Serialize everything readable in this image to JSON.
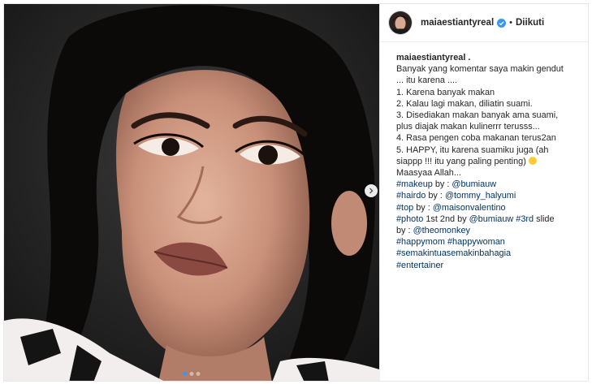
{
  "post": {
    "username": "maiaestiantyreal",
    "separator": "•",
    "follow_label": "Diikuti",
    "caption_author": "maiaestiantyreal .",
    "caption_lines": [
      "Banyak yang komentar saya makin gendut",
      "... itu karena ....",
      "1. Karena banyak makan",
      "2. Kalau lagi makan, diliatin suami.",
      "3. Disediakan makan banyak ama suami,",
      "plus diajak makan kulinerrr terusss...",
      "4. Rasa pengen coba makanan terus2an",
      "5. HAPPY, itu karena suamiku juga (ah",
      "siappp !!! itu yang paling penting)",
      "Maasyaa Allah..."
    ],
    "credits": {
      "makeup_tag": "#makeup",
      "makeup_by": " by : ",
      "makeup_mention": "@bumiauw",
      "hairdo_tag": "#hairdo",
      "hairdo_by": " by : ",
      "hairdo_mention": "@tommy_halyumi",
      "top_tag": "#top",
      "top_by": " by : ",
      "top_mention": "@maisonvalentino",
      "photo_tag": "#photo",
      "photo_text": " 1st 2nd by ",
      "photo_mention": "@bumiauw",
      "slide_tag": "#3rd",
      "slide_text": " slide",
      "by_label": "by : ",
      "theomonkey": "@theomonkey"
    },
    "hashtags_line1": [
      "#happymom",
      "#happywoman"
    ],
    "hashtag_line2": "#semakintuasemakinbahagia",
    "hashtag_line3": "#entertainer"
  },
  "carousel": {
    "slides": 3,
    "current": 1
  },
  "icons": {
    "verified": "verified-badge-icon",
    "next": "chevron-right-icon",
    "emoji": "laughing-emoji-icon"
  },
  "colors": {
    "link": "#003569",
    "verified": "#3897f0",
    "text": "#262626",
    "border": "#efefef"
  }
}
